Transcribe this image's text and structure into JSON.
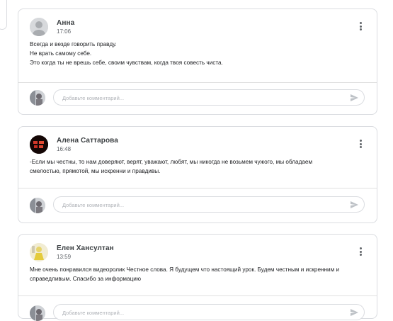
{
  "posts": [
    {
      "author": "Анна",
      "time": "17:06",
      "lines": [
        "Всегда и везде говорить правду.",
        "Не врать самому себе.",
        "Это когда ты не врешь себе, своим чувствам, когда твоя совесть чиста."
      ],
      "avatar": "grey-person-avatar",
      "comment_placeholder": "Добавьте комментарий..."
    },
    {
      "author": "Алена Саттарова",
      "time": "16:48",
      "lines": [
        "-Если мы честны, то нам доверяют, верят, уважают, любят, мы никогда не возьмем чужого, мы обладаем",
        "смелостью, прямотой, мы искренни и правдивы."
      ],
      "avatar": "dark-red-avatar",
      "comment_placeholder": "Добавьте комментарий..."
    },
    {
      "author": "Елен Хансултан",
      "time": "13:59",
      "lines": [
        "Мне очень понравился видеоролик Честное слова. Я будущем что настоящий урок. Будем честным и искренним и",
        "справедливым. Спасибо за информацию"
      ],
      "avatar": "yellow-figure-avatar",
      "comment_placeholder": "Добавьте комментарий..."
    }
  ],
  "icons": {
    "menu": "more-vert-icon",
    "send": "send-icon"
  },
  "colors": {
    "border": "#dadce0",
    "text": "#202124",
    "muted": "#5f6368"
  }
}
